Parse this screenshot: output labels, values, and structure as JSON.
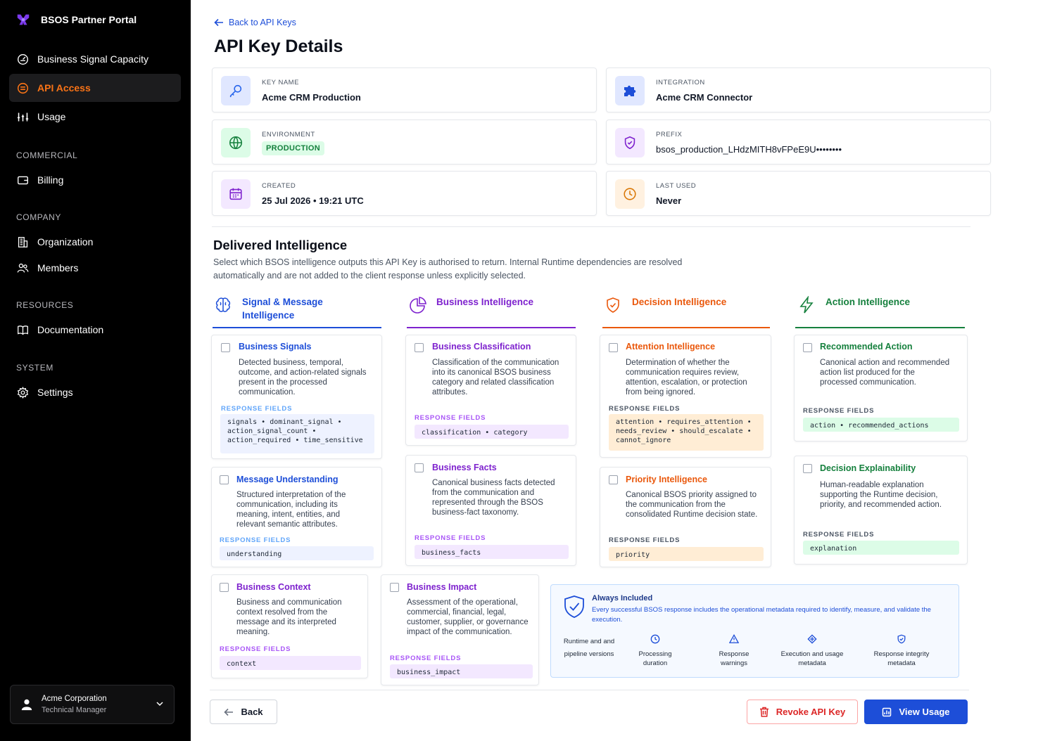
{
  "app": {
    "title": "BSOS Partner Portal"
  },
  "sidebar": {
    "items": [
      {
        "label": "Business Signal Capacity"
      },
      {
        "label": "API Access"
      },
      {
        "label": "Usage"
      }
    ],
    "sections": {
      "commercial": {
        "label": "COMMERCIAL",
        "items": [
          {
            "label": "Billing"
          }
        ]
      },
      "company": {
        "label": "COMPANY",
        "items": [
          {
            "label": "Organization"
          },
          {
            "label": "Members"
          }
        ]
      },
      "resources": {
        "label": "RESOURCES",
        "items": [
          {
            "label": "Documentation"
          }
        ]
      },
      "system": {
        "label": "SYSTEM",
        "items": [
          {
            "label": "Settings"
          }
        ]
      }
    },
    "user": {
      "name": "Acme Corporation",
      "role": "Technical Manager"
    }
  },
  "header": {
    "back_link": "Back to API Keys",
    "title": "API Key Details"
  },
  "details": {
    "key_name": {
      "label": "KEY NAME",
      "value": "Acme CRM Production"
    },
    "integration": {
      "label": "INTEGRATION",
      "value": "Acme CRM Connector"
    },
    "environment": {
      "label": "ENVIRONMENT",
      "value": "PRODUCTION"
    },
    "prefix": {
      "label": "PREFIX",
      "value": "bsos_production_LHdzMITH8vFPeE9U••••••••"
    },
    "created": {
      "label": "CREATED",
      "value": "25 Jul 2026 • 19:21 UTC"
    },
    "last_used": {
      "label": "LAST USED",
      "value": "Never"
    }
  },
  "delivered": {
    "title": "Delivered Intelligence",
    "description": "Select which BSOS intelligence outputs this API Key is authorised to return. Internal Runtime dependencies are resolved automatically and are not added to the client response unless explicitly selected.",
    "response_fields_label": "RESPONSE FIELDS",
    "columns": [
      {
        "title": "Signal & Message Intelligence",
        "color": "#1d4ed8"
      },
      {
        "title": "Business Intelligence",
        "color": "#7e22ce"
      },
      {
        "title": "Decision Intelligence",
        "color": "#ea580c"
      },
      {
        "title": "Action Intelligence",
        "color": "#15803d"
      }
    ],
    "cards": {
      "business_signals": {
        "title": "Business Signals",
        "desc": "Detected business, temporal, outcome, and action-related signals present in the processed communication.",
        "fields": "signals • dominant_signal • action_signal_count • action_required • time_sensitive"
      },
      "message_understanding": {
        "title": "Message Understanding",
        "desc": "Structured interpretation of the communication, including its meaning, intent, entities, and relevant semantic attributes.",
        "fields": "understanding"
      },
      "business_context": {
        "title": "Business Context",
        "desc": "Business and communication context resolved from the message and its interpreted meaning.",
        "fields": "context"
      },
      "business_classification": {
        "title": "Business Classification",
        "desc": "Classification of the communication into its canonical BSOS business category and related classification attributes.",
        "fields": "classification • category"
      },
      "business_facts": {
        "title": "Business Facts",
        "desc": "Canonical business facts detected from the communication and represented through the BSOS business-fact taxonomy.",
        "fields": "business_facts"
      },
      "business_impact": {
        "title": "Business Impact",
        "desc": "Assessment of the operational, commercial, financial, legal, customer, supplier, or governance impact of the communication.",
        "fields": "business_impact"
      },
      "attention_intelligence": {
        "title": "Attention Intelligence",
        "desc": "Determination of whether the communication requires review, attention, escalation, or protection from being ignored.",
        "fields": "attention • requires_attention • needs_review • should_escalate • cannot_ignore"
      },
      "priority_intelligence": {
        "title": "Priority Intelligence",
        "desc": "Canonical BSOS priority assigned to the communication from the consolidated Runtime decision state.",
        "fields": "priority"
      },
      "recommended_action": {
        "title": "Recommended Action",
        "desc": "Canonical action and recommended action list produced for the processed communication.",
        "fields": "action • recommended_actions"
      },
      "decision_explainability": {
        "title": "Decision Explainability",
        "desc": "Human-readable explanation supporting the Runtime decision, priority, and recommended action.",
        "fields": "explanation"
      }
    },
    "always_included": {
      "title": "Always Included",
      "description": "Every successful BSOS response includes the operational metadata required to identify, measure, and validate the execution.",
      "items": [
        {
          "label": "Runtime and and pipeline versions"
        },
        {
          "label": "Processing duration"
        },
        {
          "label": "Response warnings"
        },
        {
          "label": "Execution and usage metadata"
        },
        {
          "label": "Response integrity metadata"
        }
      ]
    }
  },
  "footer": {
    "back": "Back",
    "revoke": "Revoke API Key",
    "view_usage": "View Usage"
  },
  "colors": {
    "accent": "#1d4ed8",
    "active_nav": "#f97316",
    "danger": "#dc2626"
  }
}
